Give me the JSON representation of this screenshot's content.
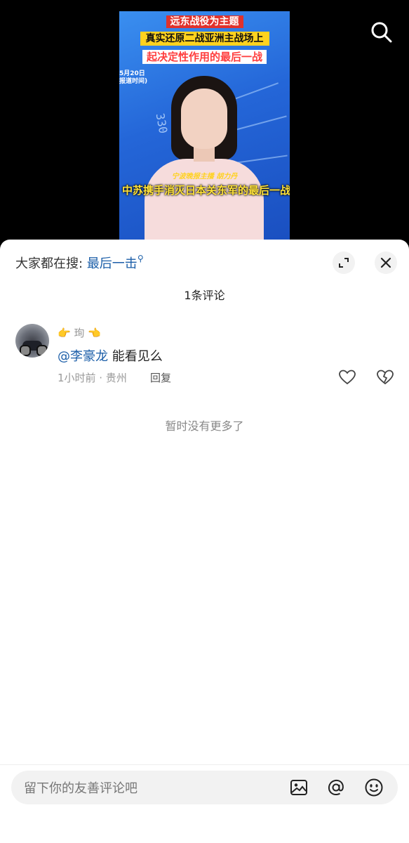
{
  "video": {
    "caption_line1": "远东战役为主题",
    "caption_line2": "真实还原二战亚洲主战场上",
    "caption_line3": "起决定性作用的最后一战",
    "date_line1": "5月20日",
    "date_line2": "报道时间)",
    "gauge_number": "330",
    "anchor_tag": "宁波晚报主播 胡力丹",
    "subtitle": "中苏携手消灭日本关东军的最后一战"
  },
  "sheet": {
    "hot_search_prefix": "大家都在搜:",
    "hot_search_keyword": "最后一击",
    "comment_count": "1条评论",
    "comments": [
      {
        "username": "👉 珣 👈",
        "mention": "@李豪龙",
        "text": " 能看见么",
        "time_location": "1小时前 · 贵州",
        "reply_label": "回复"
      }
    ],
    "no_more": "暂时没有更多了"
  },
  "input": {
    "placeholder": "留下你的友善评论吧"
  },
  "colors": {
    "link": "#1b5ea8",
    "sheet_bg": "#ffffff",
    "input_bg": "#f2f2f2"
  }
}
